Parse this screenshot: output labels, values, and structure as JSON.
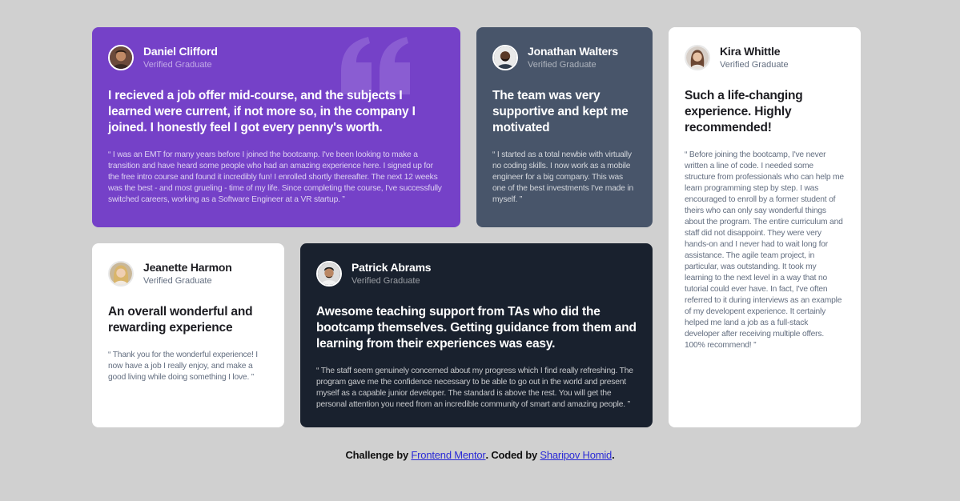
{
  "testimonials": [
    {
      "name": "Daniel Clifford",
      "role": "Verified Graduate",
      "headline": "I recieved a job offer mid-course, and the subjects I learned were current, if not more so, in the company I joined. I honestly feel I got every penny's worth.",
      "body": "“ I was an EMT for many years before I joined the bootcamp. I've been looking to make a transition and have heard some people who had an amazing experience here. I signed up for the free intro course and found it incredibly fun! I enrolled shortly thereafter. The next 12 weeks was the best - and most grueling - time of my life. Since completing the course, I've successfully switched careers, working as a Software Engineer at a VR startup. ”",
      "card_color": "#7541c8"
    },
    {
      "name": "Jonathan Walters",
      "role": "Verified Graduate",
      "headline": "The team was very supportive and kept me motivated",
      "body": "“ I started as a total newbie with virtually no coding skills. I now work as a mobile engineer for a big company. This was one of the best investments I've made in myself. ”",
      "card_color": "#48556a"
    },
    {
      "name": "Kira Whittle",
      "role": "Verified Graduate",
      "headline": "Such a life-changing experience. Highly recommended!",
      "body": "“ Before joining the bootcamp, I've never written a line of code. I needed some structure from professionals who can help me learn programming step by step. I was encouraged to enroll by a former student of theirs who can only say wonderful things about the program. The entire curriculum and staff did not disappoint. They were very hands-on and I never had to wait long for assistance. The agile team project, in particular, was outstanding. It took my learning to the next level in a way that no tutorial could ever have. In fact, I've often referred to it during interviews as an example of my developent experience. It certainly helped me land a job as a full-stack developer after receiving multiple offers. 100% recommend! ”",
      "card_color": "#ffffff"
    },
    {
      "name": "Jeanette Harmon",
      "role": "Verified Graduate",
      "headline": "An overall wonderful and rewarding experience",
      "body": "“ Thank you for the wonderful experience! I now have a job I really enjoy, and make a good living while doing something I love. ”",
      "card_color": "#ffffff"
    },
    {
      "name": "Patrick Abrams",
      "role": "Verified Graduate",
      "headline": "Awesome teaching support from TAs who did the bootcamp themselves. Getting guidance from them and learning from their experiences was easy.",
      "body": "“ The staff seem genuinely concerned about my progress which I find really refreshing. The program gave me the confidence necessary to be able to go out in the world and present myself as a capable junior developer. The standard is above the rest. You will get the personal attention you need from an incredible community of smart and amazing people. ”",
      "card_color": "#19212e"
    }
  ],
  "footer": {
    "prefix": "Challenge by",
    "link1": "Frontend Mentor",
    "middle": ". Coded by",
    "link2": "Sharipov Homid",
    "suffix": "."
  },
  "icons": {
    "quote": "quotation-mark-icon"
  },
  "colors": {
    "background": "#d0d0d0",
    "purple": "#7541c8",
    "slate": "#48556a",
    "navy": "#19212e",
    "white": "#ffffff",
    "link": "#2a2ad6"
  }
}
